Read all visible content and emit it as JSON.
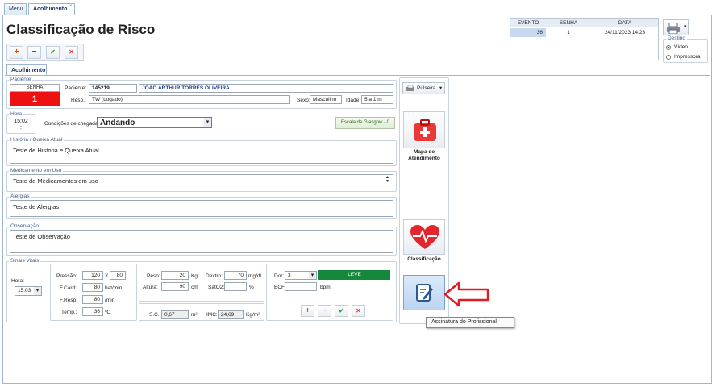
{
  "tabs": {
    "menu": "Menu",
    "acolhimento": "Acolhimento"
  },
  "page_title": "Classificação de Risco",
  "event_table": {
    "headers": [
      "EVENTO",
      "SENHA",
      "DATA"
    ],
    "row": [
      "36",
      "1",
      "24/11/2023 14:23"
    ]
  },
  "destino": {
    "title": "Destino",
    "video": "Vídeo",
    "impressora": "Impressora"
  },
  "inner_tab": "Acolhimento",
  "paciente": {
    "legend": "Paciente",
    "senha_label": "SENHA",
    "senha_value": "1",
    "paciente_label": "Paciente:",
    "id": "145219",
    "name": "JOAO ARTHUR TORRES OLIVEIRA",
    "resp_label": "Resp.:",
    "resp_value": "TW (Logado)",
    "sexo_label": "Sexo:",
    "sexo_value": "Masculino",
    "idade_label": "Idade:",
    "idade_value": "5 a 1 m"
  },
  "hora": {
    "legend": "Hora",
    "value": "15:02",
    "sub": ":"
  },
  "chegada": {
    "label": "Condições de chegada:",
    "value": "Andando"
  },
  "glasgow_button": "Escala de Glasgow - 0",
  "historia": {
    "legend": "História / Queixa Atual",
    "text": "Teste de Historia e Queixa Atual"
  },
  "medicamento": {
    "legend": "Medicamento em Uso",
    "text": "Teste de Medicamentos em uso"
  },
  "alergias": {
    "legend": "Alergias",
    "text": "Teste de Alergias"
  },
  "observacao": {
    "legend": "Observação",
    "text": "Teste de Observação"
  },
  "sinais": {
    "legend": "Sinais Vitais",
    "hora_label": "Hora:",
    "hora_value": "15:03",
    "pressao_label": "Pressão:",
    "pressao_1": "120",
    "pressao_x": "X",
    "pressao_2": "80",
    "fcard_label": "F.Card:",
    "fcard_value": "80",
    "fcard_unit": "bat/min",
    "fresp_label": "F.Resp:",
    "fresp_value": "80",
    "fresp_unit": "/min",
    "temp_label": "Temp.:",
    "temp_value": "36",
    "temp_unit": "ºC",
    "peso_label": "Peso:",
    "peso_value": "20",
    "peso_unit": "Kg",
    "altura_label": "Altura:",
    "altura_value": "90",
    "altura_unit": "cm",
    "dextro_label": "Dextro:",
    "dextro_value": "70",
    "dextro_unit": "mg/dl",
    "sat_label": "SatO2:",
    "sat_value": "",
    "sat_unit": "%",
    "sc_label": "S.C.:",
    "sc_value": "0,67",
    "sc_unit": "m²",
    "imc_label": "IMC:",
    "imc_value": "24,69",
    "imc_unit": "Kg/m²",
    "dor_label": "Dor:",
    "dor_value": "3",
    "dor_level": "LEVE",
    "bcf_label": "BCF:",
    "bcf_value": "",
    "bcf_unit": "bpm"
  },
  "side": {
    "pulseira": "Pulseira",
    "mapa": "Mapa de Atendimento",
    "classificacao": "Classificação"
  },
  "tooltip": "Assinatura do Profissional",
  "colors": {
    "senha_red": "#ee1111",
    "leve_green": "#16883a",
    "arrow_red": "#e31b23"
  }
}
